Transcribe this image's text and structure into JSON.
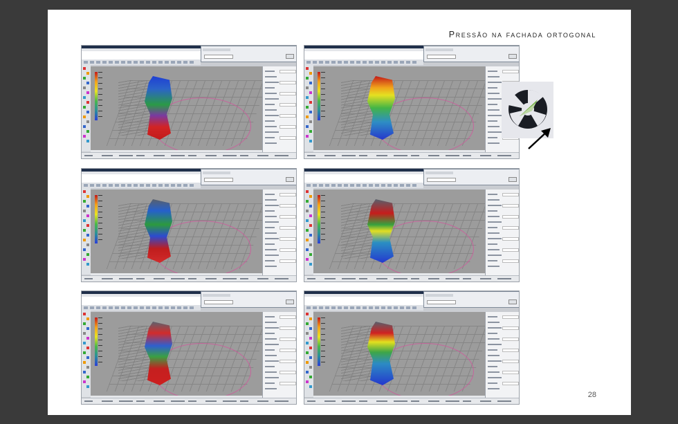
{
  "slide": {
    "title": "Pressão na fachada ortogonal",
    "page_number": "28"
  },
  "screens": [
    {
      "id": "s1",
      "tower": "linear-gradient(180deg,#1f3fd3 0%,#2b63c9 20%,#2b9a46 45%,#7a3aa0 62%,#d22424 80%,#c11b1b 100%)",
      "legend": [
        "1.2667",
        "1",
        "0.9",
        "0.8",
        "0.7",
        "0.6",
        "0.5",
        "0.4",
        "0.3"
      ]
    },
    {
      "id": "s2",
      "tower": "linear-gradient(180deg,#c31919 0%,#f0a21a 18%,#e5e021 30%,#44b546 50%,#2e8ec4 72%,#2637cc 100%)",
      "legend": [
        "2401.21",
        "2300",
        "2200",
        "2100",
        "2000",
        "1900",
        "1800",
        "1700",
        "1600"
      ]
    },
    {
      "id": "s3",
      "tower": "linear-gradient(180deg,#58606c 0%,#2560cc 18%,#2c9a3e 40%,#2c4bd0 58%,#c01d1d 78%,#d12b2b 100%)",
      "legend": [
        "1.2667",
        "1",
        "0.9",
        "0.8",
        "0.7",
        "0.6",
        "0.5",
        "0.4",
        "0.3"
      ]
    },
    {
      "id": "s4",
      "tower": "linear-gradient(180deg,#58606c 0%,#c61c1c 22%,#37a03e 40%,#e2de22 50%,#2b8fc2 68%,#2439cf 100%)",
      "legend": [
        "2401.21",
        "2300",
        "2200",
        "2100",
        "2000",
        "1900",
        "1800",
        "1700",
        "1600"
      ]
    },
    {
      "id": "s5",
      "tower": "linear-gradient(180deg,#5c636e 0%,#d32b2b 18%,#2f5fcf 38%,#3aa043 55%,#c51f1f 74%,#cc1f1f 100%)",
      "legend": [
        "1.2667",
        "1",
        "0.9",
        "0.8",
        "0.7",
        "0.6",
        "0.5",
        "0.4",
        "0.3"
      ]
    },
    {
      "id": "s6",
      "tower": "linear-gradient(180deg,#58606c 0%,#d02121 18%,#e3df1f 32%,#3ea647 48%,#2c8bc4 66%,#2437cd 100%)",
      "legend": [
        "2401.21",
        "2300",
        "2200",
        "2100",
        "2000",
        "1900",
        "1800",
        "1700",
        "1600"
      ]
    }
  ],
  "icons": {
    "compass_badge": "compass-icon",
    "pointer_arrow": "arrow-icon"
  },
  "colors": {
    "background": "#3a3a3a",
    "slide": "#ffffff",
    "accent_pink": "#d94f9c"
  }
}
